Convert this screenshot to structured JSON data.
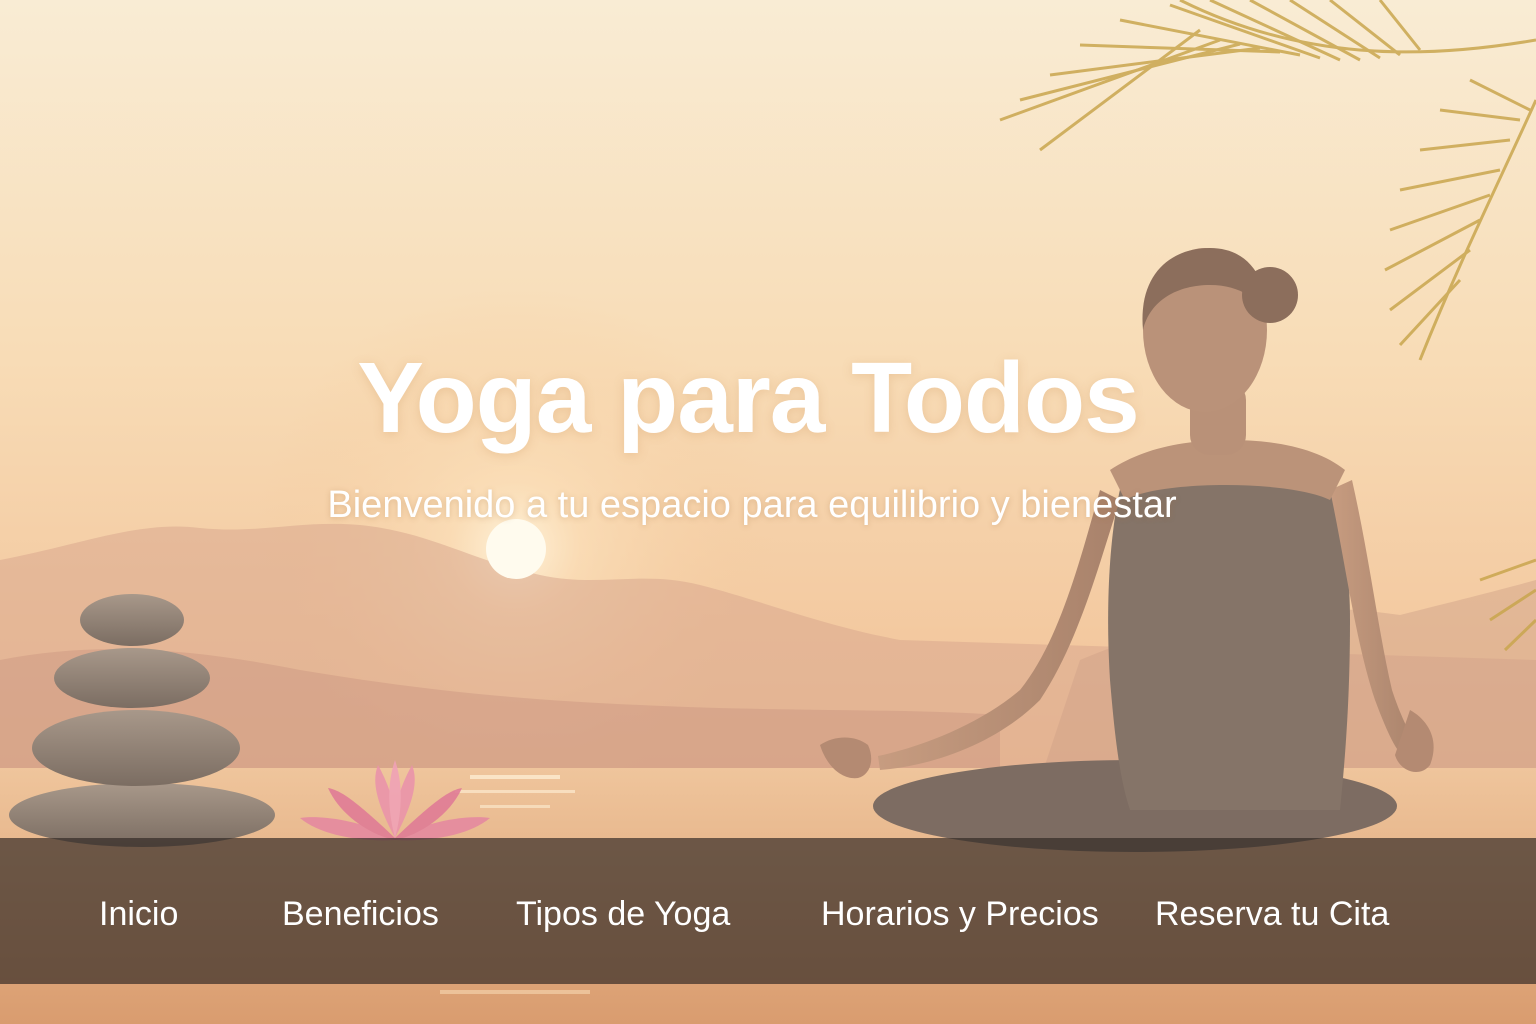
{
  "hero": {
    "title": "Yoga para Todos",
    "subtitle": "Bienvenido a tu espacio para equilibrio y bienestar"
  },
  "nav": {
    "items": [
      {
        "label": "Inicio"
      },
      {
        "label": "Beneficios"
      },
      {
        "label": "Tipos de Yoga"
      },
      {
        "label": "Horarios y Precios"
      },
      {
        "label": "Reserva tu Cita"
      }
    ]
  },
  "colors": {
    "sky_top": "#f8ead0",
    "sky_glow": "#f5c99a",
    "water": "#e9b689",
    "nav_bar": "#302824",
    "text": "#ffffff"
  },
  "background_scene": [
    "sunset-sky",
    "sun",
    "mountains",
    "lake",
    "stacked-stones",
    "lotus-flower",
    "meditating-woman",
    "palm-leaves"
  ]
}
